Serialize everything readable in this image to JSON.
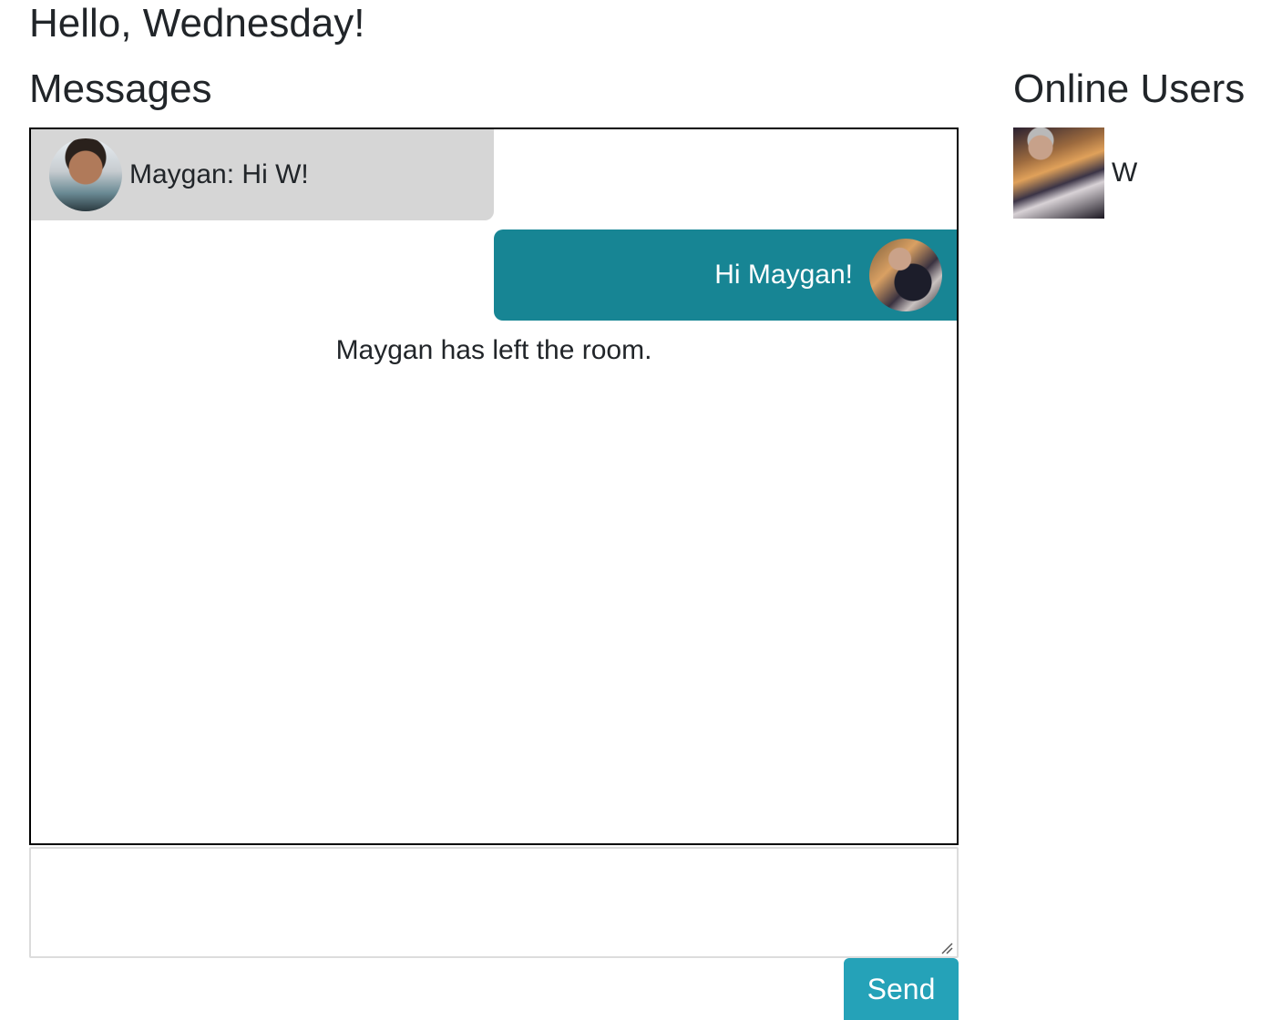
{
  "header": {
    "greeting": "Hello, Wednesday!"
  },
  "messages_panel": {
    "heading": "Messages",
    "items": [
      {
        "kind": "received",
        "text": "Maygan: Hi W!",
        "avatar_icon": "user-avatar-maygan",
        "bubble_color": "#d6d6d6"
      },
      {
        "kind": "sent",
        "text": "Hi Maygan!",
        "avatar_icon": "user-avatar-wednesday",
        "bubble_color": "#178594"
      },
      {
        "kind": "system",
        "text": "Maygan has left the room."
      }
    ]
  },
  "composer": {
    "value": "",
    "placeholder": "",
    "send_label": "Send",
    "send_color": "#25a2b8"
  },
  "online_users": {
    "heading": "Online Users",
    "users": [
      {
        "name": "W",
        "avatar_icon": "user-avatar-wednesday"
      }
    ]
  }
}
